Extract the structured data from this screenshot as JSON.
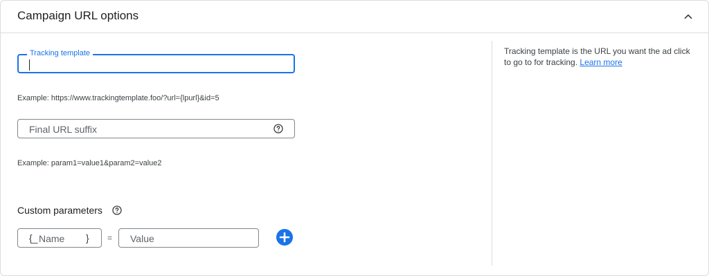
{
  "header": {
    "title": "Campaign URL options",
    "collapse_icon": "chevron-up-icon"
  },
  "tracking_template": {
    "label": "Tracking template",
    "value": "",
    "example": "Example: https://www.trackingtemplate.foo/?url={lpurl}&id=5"
  },
  "final_url_suffix": {
    "placeholder": "Final URL suffix",
    "help_icon": "help-circle-icon",
    "example": "Example: param1=value1&param2=value2"
  },
  "custom_parameters": {
    "label": "Custom parameters",
    "help_icon": "help-circle-icon",
    "name_open_brace": "{_",
    "name_placeholder": "Name",
    "name_close_brace": "}",
    "equals": "=",
    "value_placeholder": "Value",
    "add_icon": "plus-circle-icon"
  },
  "help_panel": {
    "text": "Tracking template is the URL you want the ad click to go to for tracking. ",
    "link": "Learn more"
  },
  "colors": {
    "accent": "#1a73e8",
    "border": "#dadce0",
    "text": "#3c4043"
  }
}
